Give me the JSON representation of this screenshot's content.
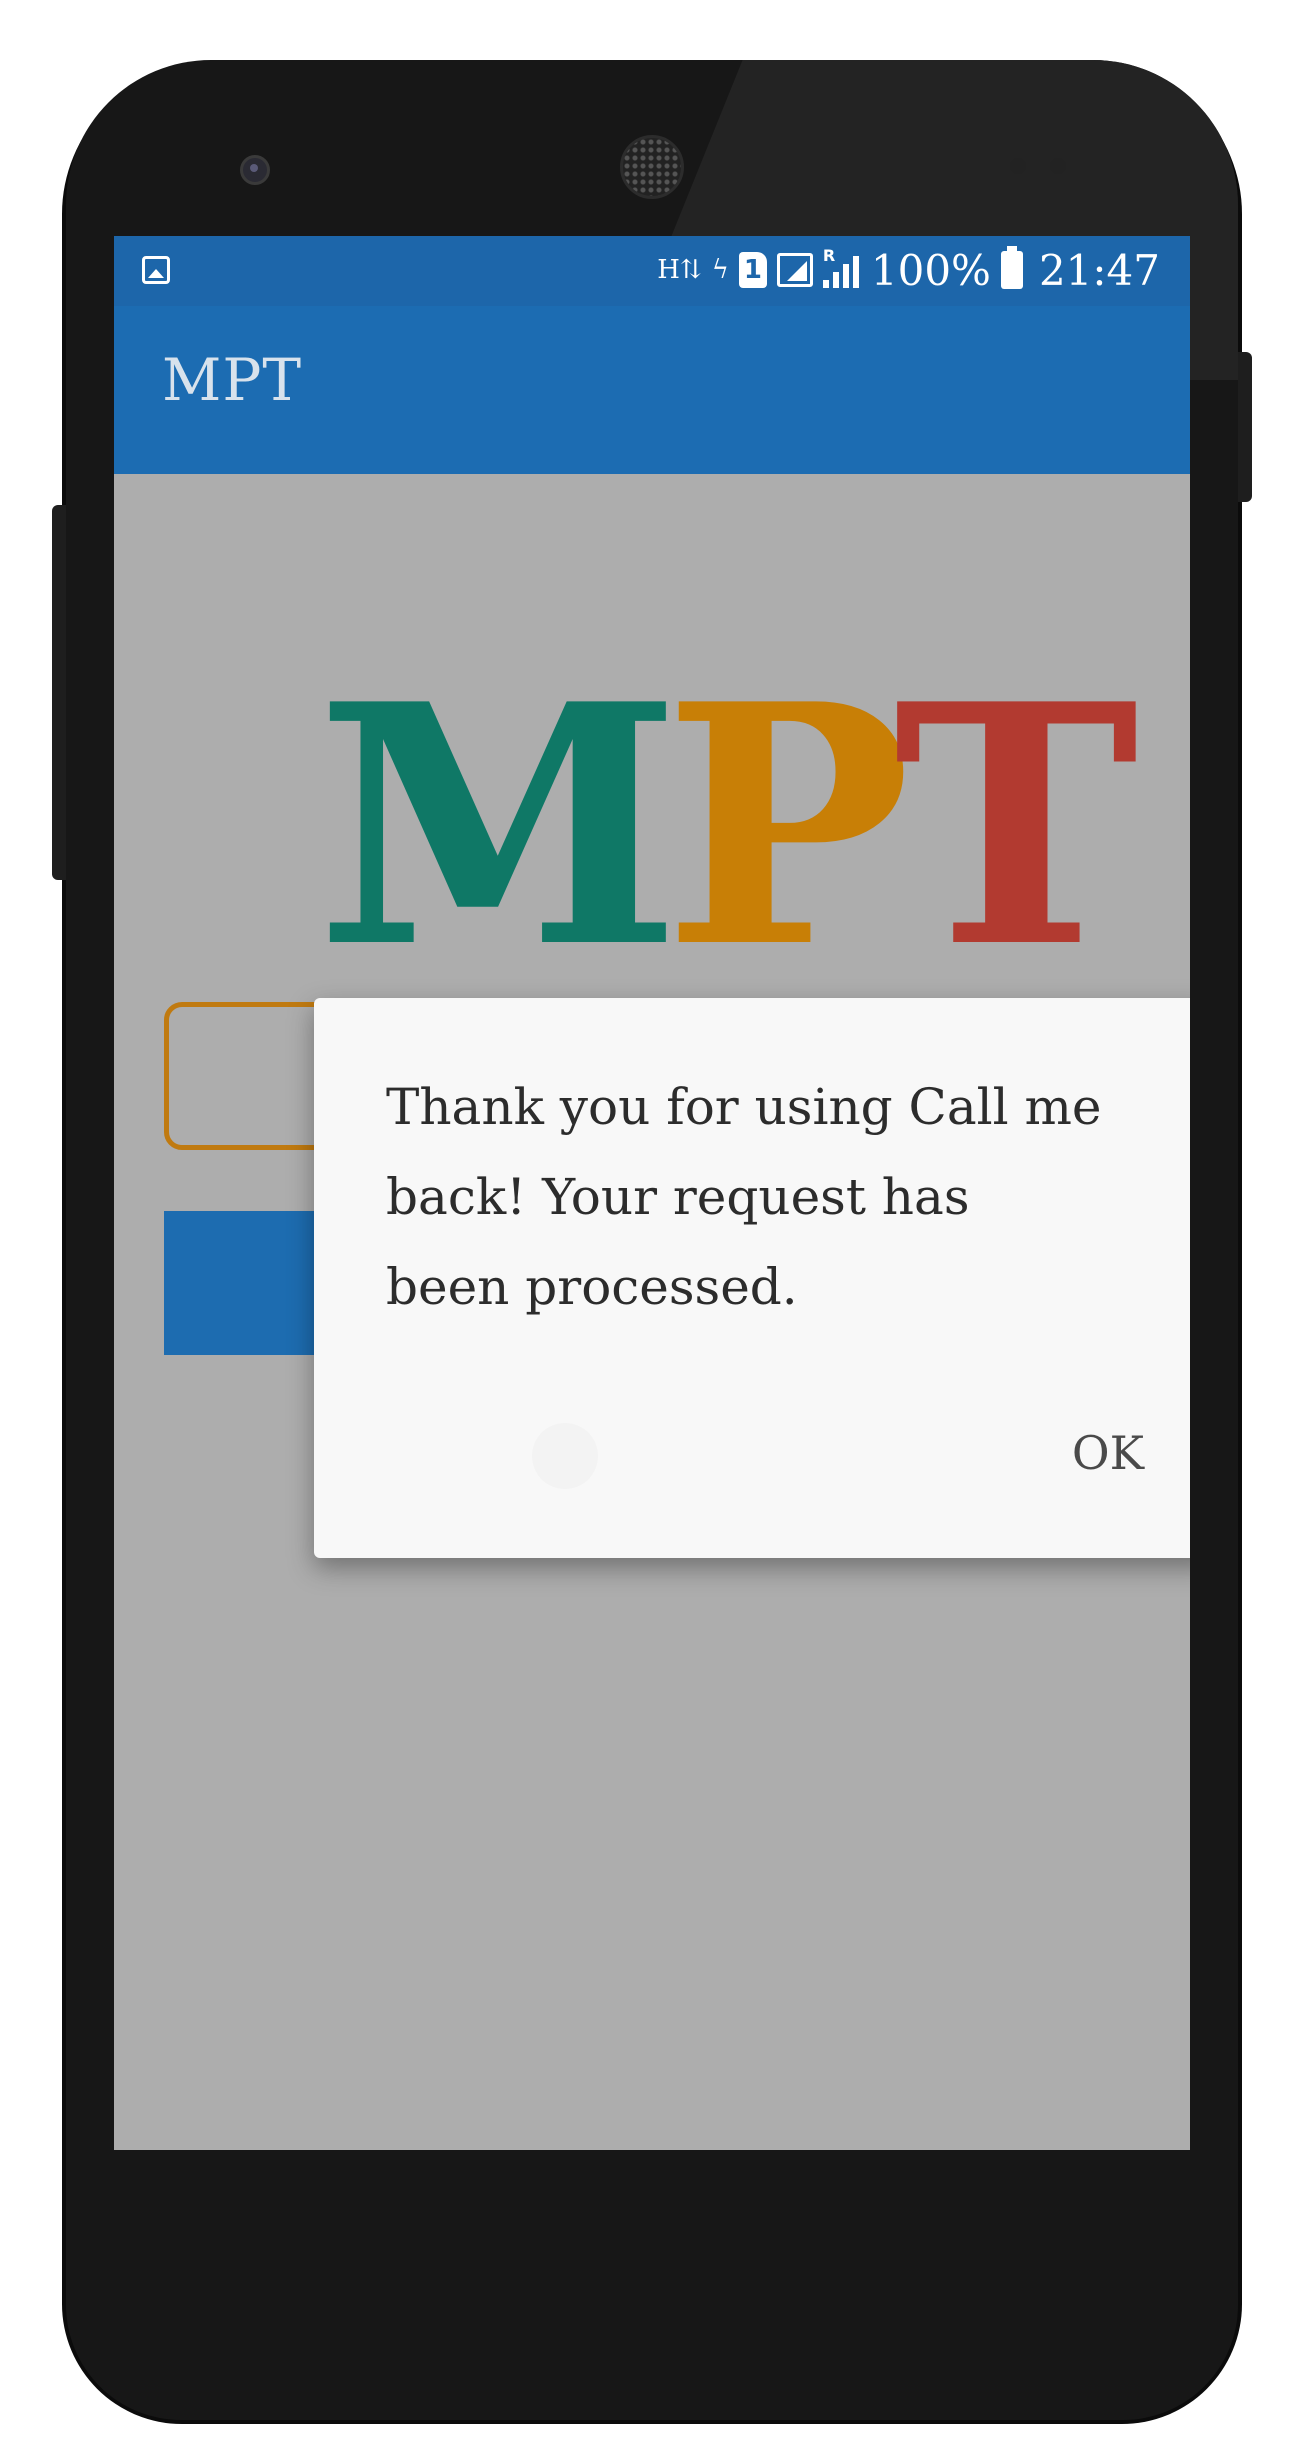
{
  "status_bar": {
    "network_h": "H",
    "battery_percent": "100%",
    "time": "21:47",
    "sim_slot": "1",
    "roaming": "R",
    "icons": [
      "gallery-icon",
      "data-h-icon",
      "sim-1-icon",
      "signal-icon",
      "roaming-signal-icon",
      "battery-icon"
    ]
  },
  "app_bar": {
    "title": "MPT"
  },
  "logo": {
    "letters": [
      "M",
      "P",
      "T"
    ],
    "colors": [
      "#0f7866",
      "#c87f06",
      "#b23a30"
    ]
  },
  "dialog": {
    "message": "Thank you for using Call me back! Your request has been processed.",
    "ok_label": "OK"
  },
  "colors": {
    "primary": "#1c6cb2",
    "status_bar": "#1d66aa",
    "scrim": "#adadad",
    "input_border": "#c07a10"
  }
}
